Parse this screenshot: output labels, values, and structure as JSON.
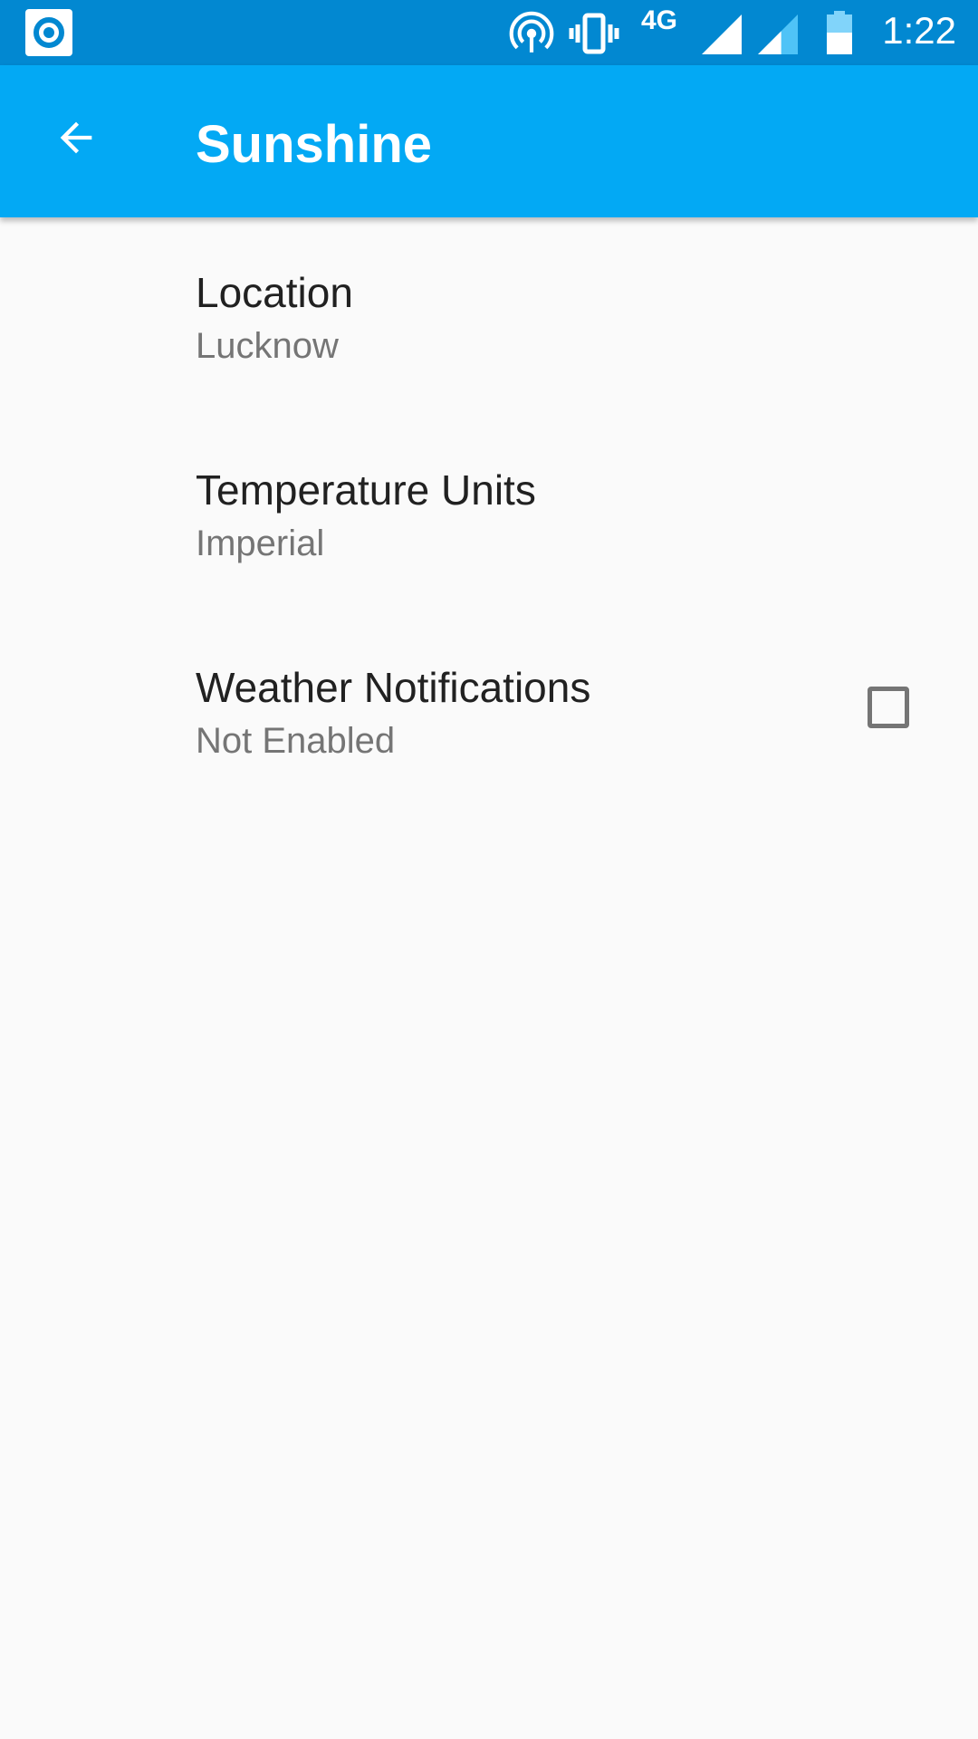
{
  "status_bar": {
    "network": "4G",
    "time": "1:22",
    "icons": [
      "app-notification-icon",
      "hotspot-icon",
      "vibrate-icon",
      "signal-icon",
      "signal-icon",
      "battery-icon"
    ]
  },
  "app_bar": {
    "title": "Sunshine",
    "back_icon": "arrow-back-icon"
  },
  "preferences": [
    {
      "title": "Location",
      "summary": "Lucknow"
    },
    {
      "title": "Temperature Units",
      "summary": "Imperial"
    },
    {
      "title": "Weather Notifications",
      "summary": "Not Enabled",
      "checked": false
    }
  ],
  "colors": {
    "status_bar": "#0288d1",
    "app_bar": "#03a9f4",
    "background": "#fafafa"
  }
}
